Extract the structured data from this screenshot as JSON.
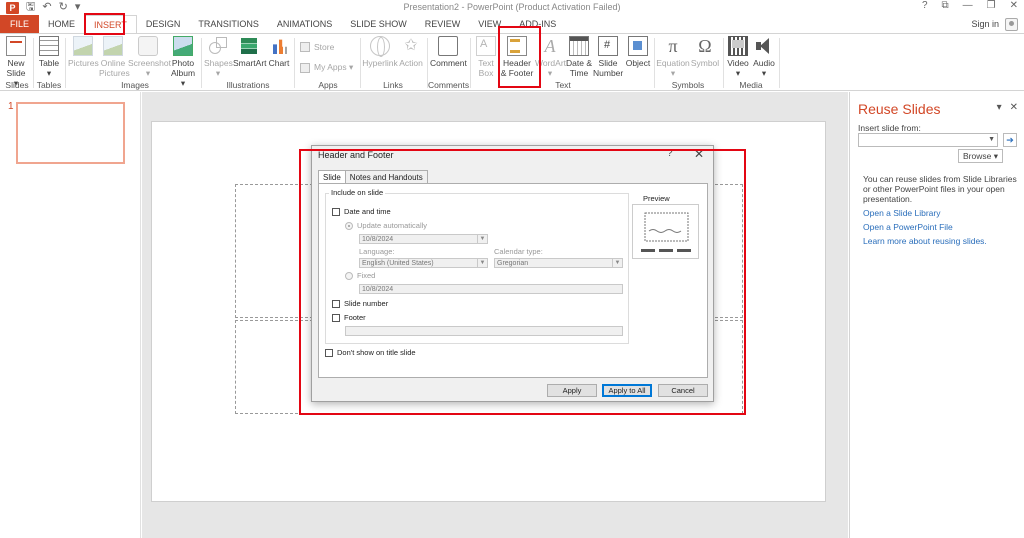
{
  "window": {
    "title": "Presentation2 - PowerPoint (Product Activation Failed)",
    "controls": [
      "?",
      "⧉",
      "—",
      "❐",
      "✕"
    ]
  },
  "qat": [
    "↶",
    "↻",
    "▾"
  ],
  "tabs": [
    "FILE",
    "HOME",
    "INSERT",
    "DESIGN",
    "TRANSITIONS",
    "ANIMATIONS",
    "SLIDE SHOW",
    "REVIEW",
    "VIEW",
    "ADD-INS"
  ],
  "account": {
    "signin": "Sign in"
  },
  "ribbon": {
    "new_slide": [
      "New",
      "Slide ▾"
    ],
    "table": [
      "Table",
      "▾"
    ],
    "pictures": [
      "Pictures"
    ],
    "online_pictures": [
      "Online",
      "Pictures"
    ],
    "screenshot": [
      "Screenshot",
      "▾"
    ],
    "photo_album": [
      "Photo",
      "Album ▾"
    ],
    "shapes": [
      "Shapes",
      "▾"
    ],
    "smartart": [
      "SmartArt"
    ],
    "chart": [
      "Chart"
    ],
    "store": "Store",
    "my_apps": "My Apps ▾",
    "hyperlink": [
      "Hyperlink"
    ],
    "action": [
      "Action"
    ],
    "comment": [
      "Comment"
    ],
    "text_box": [
      "Text",
      "Box"
    ],
    "header_footer": [
      "Header",
      "& Footer"
    ],
    "wordart": [
      "WordArt",
      "▾"
    ],
    "date_time": [
      "Date &",
      "Time"
    ],
    "slide_number": [
      "Slide",
      "Number"
    ],
    "object": [
      "Object"
    ],
    "equation": [
      "Equation",
      "▾"
    ],
    "symbol": [
      "Symbol"
    ],
    "video": [
      "Video",
      "▾"
    ],
    "audio": [
      "Audio",
      "▾"
    ],
    "groups": [
      "Slides",
      "Tables",
      "Images",
      "Illustrations",
      "Apps",
      "Links",
      "Comments",
      "Text",
      "Symbols",
      "Media"
    ]
  },
  "thumbnails": {
    "number": "1"
  },
  "reuse": {
    "title": "Reuse Slides",
    "controls": [
      "▾",
      "✕"
    ],
    "insert_label": "Insert slide from:",
    "combo_value": "",
    "go": "➔",
    "browse": "Browse ▾",
    "description": "You can reuse slides from Slide Libraries or other PowerPoint files in your open presentation.",
    "links": [
      "Open a Slide Library",
      "Open a PowerPoint File",
      "Learn more about reusing slides."
    ]
  },
  "dialog": {
    "title": "Header and Footer",
    "help": "?",
    "close": "✕",
    "tabs": [
      "Slide",
      "Notes and Handouts"
    ],
    "include_group": "Include on slide",
    "date_time": "Date and time",
    "update_auto": "Update automatically",
    "auto_date": "10/8/2024",
    "language_label": "Language:",
    "language_value": "English (United States)",
    "calendar_label": "Calendar type:",
    "calendar_value": "Gregorian",
    "fixed": "Fixed",
    "fixed_date": "10/8/2024",
    "slide_number": "Slide number",
    "footer": "Footer",
    "footer_value": "",
    "dont_show": "Don't show on title slide",
    "preview": "Preview",
    "apply": "Apply",
    "apply_all": "Apply to All",
    "cancel": "Cancel"
  },
  "colors": {
    "accent": "#d24726",
    "annotation": "#e30613",
    "link": "#2a6ebb"
  }
}
